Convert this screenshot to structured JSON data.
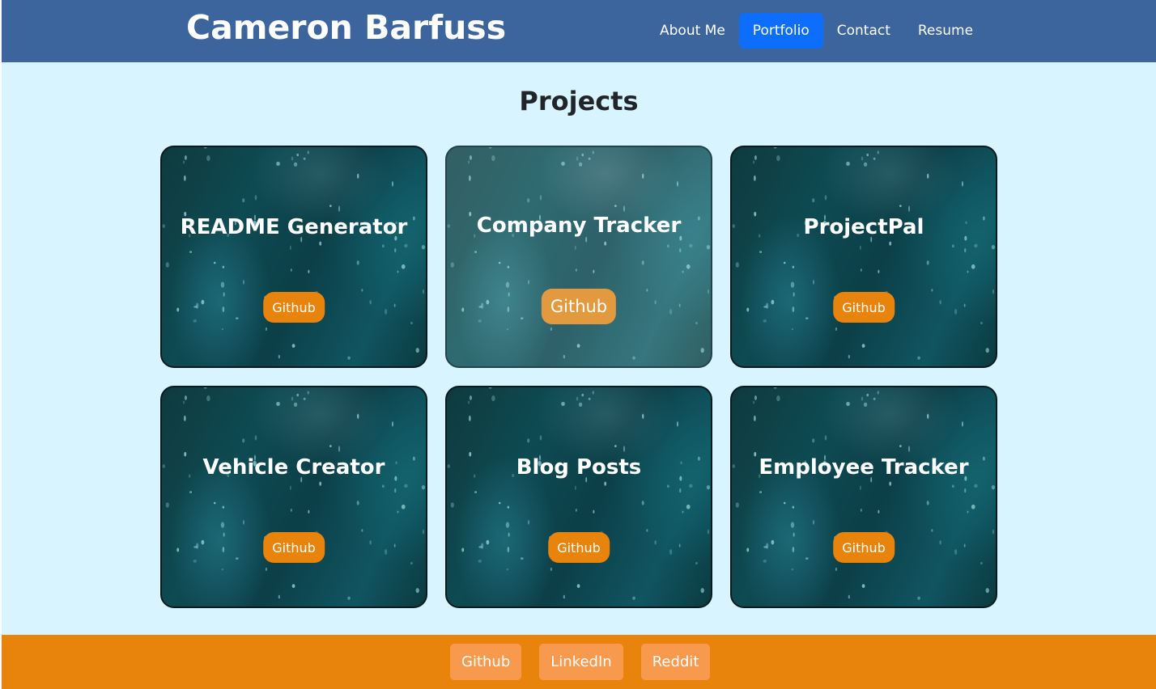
{
  "header": {
    "site_title": "Cameron Barfuss",
    "nav": [
      {
        "label": "About Me",
        "active": false
      },
      {
        "label": "Portfolio",
        "active": true
      },
      {
        "label": "Contact",
        "active": false
      },
      {
        "label": "Resume",
        "active": false
      }
    ]
  },
  "main": {
    "heading": "Projects",
    "projects": [
      {
        "title": "README Generator",
        "button_label": "Github"
      },
      {
        "title": "Company Tracker",
        "button_label": "Github",
        "state": "hovered"
      },
      {
        "title": "ProjectPal",
        "button_label": "Github"
      },
      {
        "title": "Vehicle Creator",
        "button_label": "Github"
      },
      {
        "title": "Blog Posts",
        "button_label": "Github"
      },
      {
        "title": "Employee Tracker",
        "button_label": "Github"
      }
    ]
  },
  "footer": {
    "links": [
      {
        "label": "Github"
      },
      {
        "label": "LinkedIn"
      },
      {
        "label": "Reddit"
      }
    ]
  },
  "colors": {
    "header_bg": "#3c649d",
    "nav_active_bg": "#0d6efd",
    "page_bg": "#d8f4ff",
    "accent_orange": "#e8830c",
    "footer_link_bg": "#f79a4e",
    "card_teal": "#0e4a52"
  }
}
